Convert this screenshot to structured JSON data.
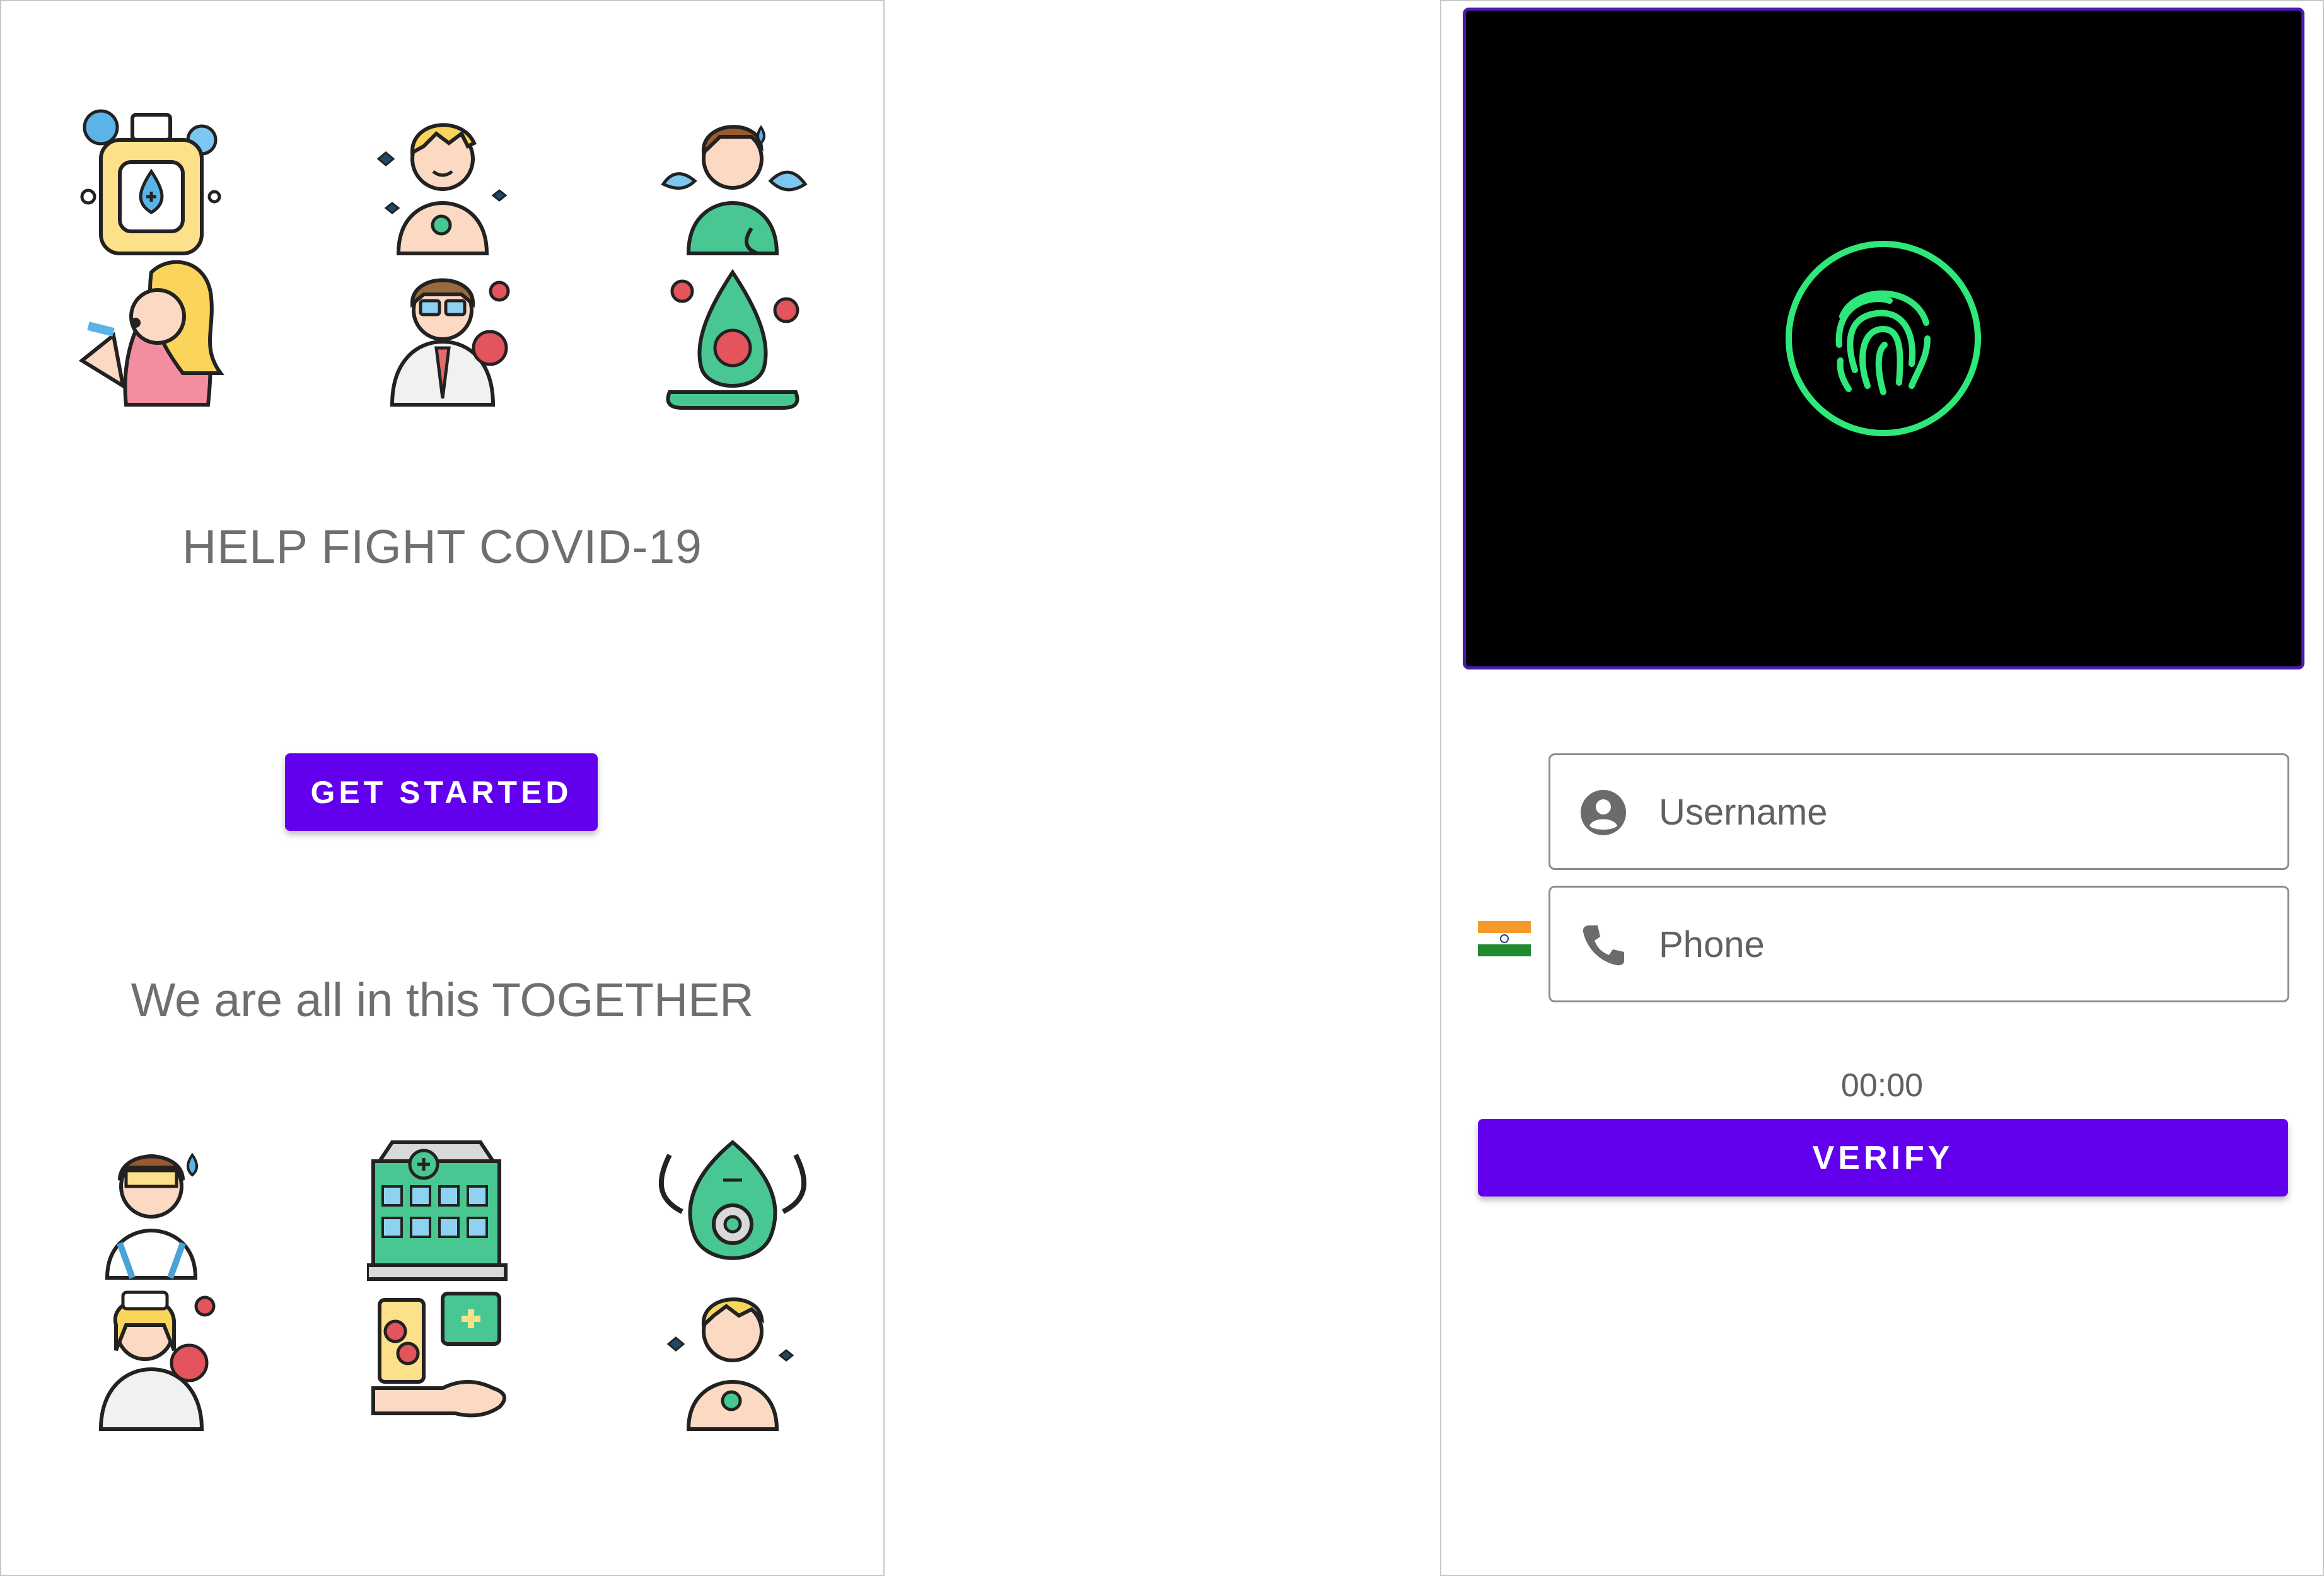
{
  "onboarding": {
    "headline": "HELP FIGHT COVID-19",
    "get_started_label": "GET STARTED",
    "tagline": "We are all in this TOGETHER"
  },
  "login": {
    "username_placeholder": "Username",
    "phone_placeholder": "Phone",
    "timer": "00:00",
    "verify_label": "VERIFY",
    "country_flag": "india-flag-icon"
  },
  "colors": {
    "accent": "#6200ee",
    "fingerprint": "#2ee87a",
    "scanner_bg": "#000000",
    "scanner_border": "#4a1aa8"
  }
}
